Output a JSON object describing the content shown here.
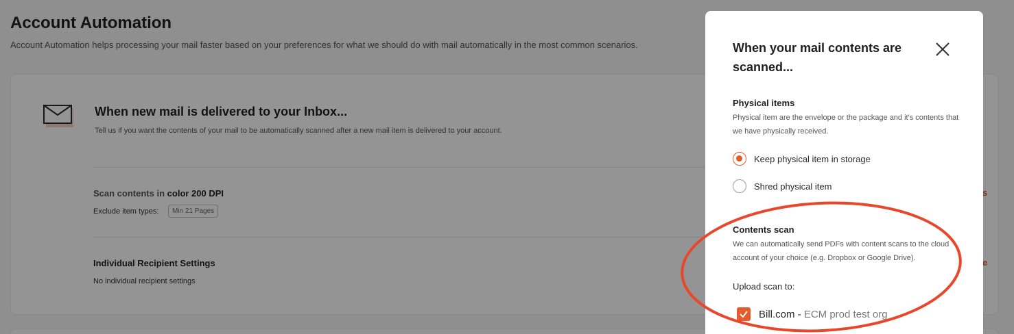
{
  "page": {
    "title": "Account Automation",
    "subtitle": "Account Automation helps processing your mail faster based on your preferences for what we should do with mail automatically in the most common scenarios."
  },
  "inbox_card": {
    "icon": "envelope-icon",
    "title": "When new mail is delivered to your Inbox...",
    "description": "Tell us if you want the contents of your mail to be automatically scanned after a new mail item is delivered to your account.",
    "scan_prefix": "Scan contents in",
    "scan_setting": "color 200 DPI",
    "exclude_label": "Exclude item types:",
    "exclude_tag": "Min 21 Pages",
    "edit_scan_fragment": "gs",
    "recipient_title": "Individual Recipient Settings",
    "recipient_desc": "No individual recipient settings",
    "edit_recipient_fragment": "ge"
  },
  "modal": {
    "title": "When your mail contents are scanned...",
    "close_icon": "close-icon",
    "physical": {
      "title": "Physical items",
      "description": "Physical item are the envelope or the package and it's contents that we have physically received.",
      "options": [
        {
          "label": "Keep physical item in storage",
          "selected": true
        },
        {
          "label": "Shred physical item",
          "selected": false
        }
      ]
    },
    "contents": {
      "title": "Contents scan",
      "description": "We can automatically send PDFs with content scans to the cloud account of your choice (e.g. Dropbox or Google Drive).",
      "upload_label": "Upload scan to:",
      "destination_name": "Bill.com -",
      "destination_detail": "ECM prod test org",
      "destination_checked": true
    }
  },
  "colors": {
    "accent": "#e25c2d",
    "annotation": "#e8472b",
    "overlay": "rgba(0,0,0,0.42)"
  }
}
